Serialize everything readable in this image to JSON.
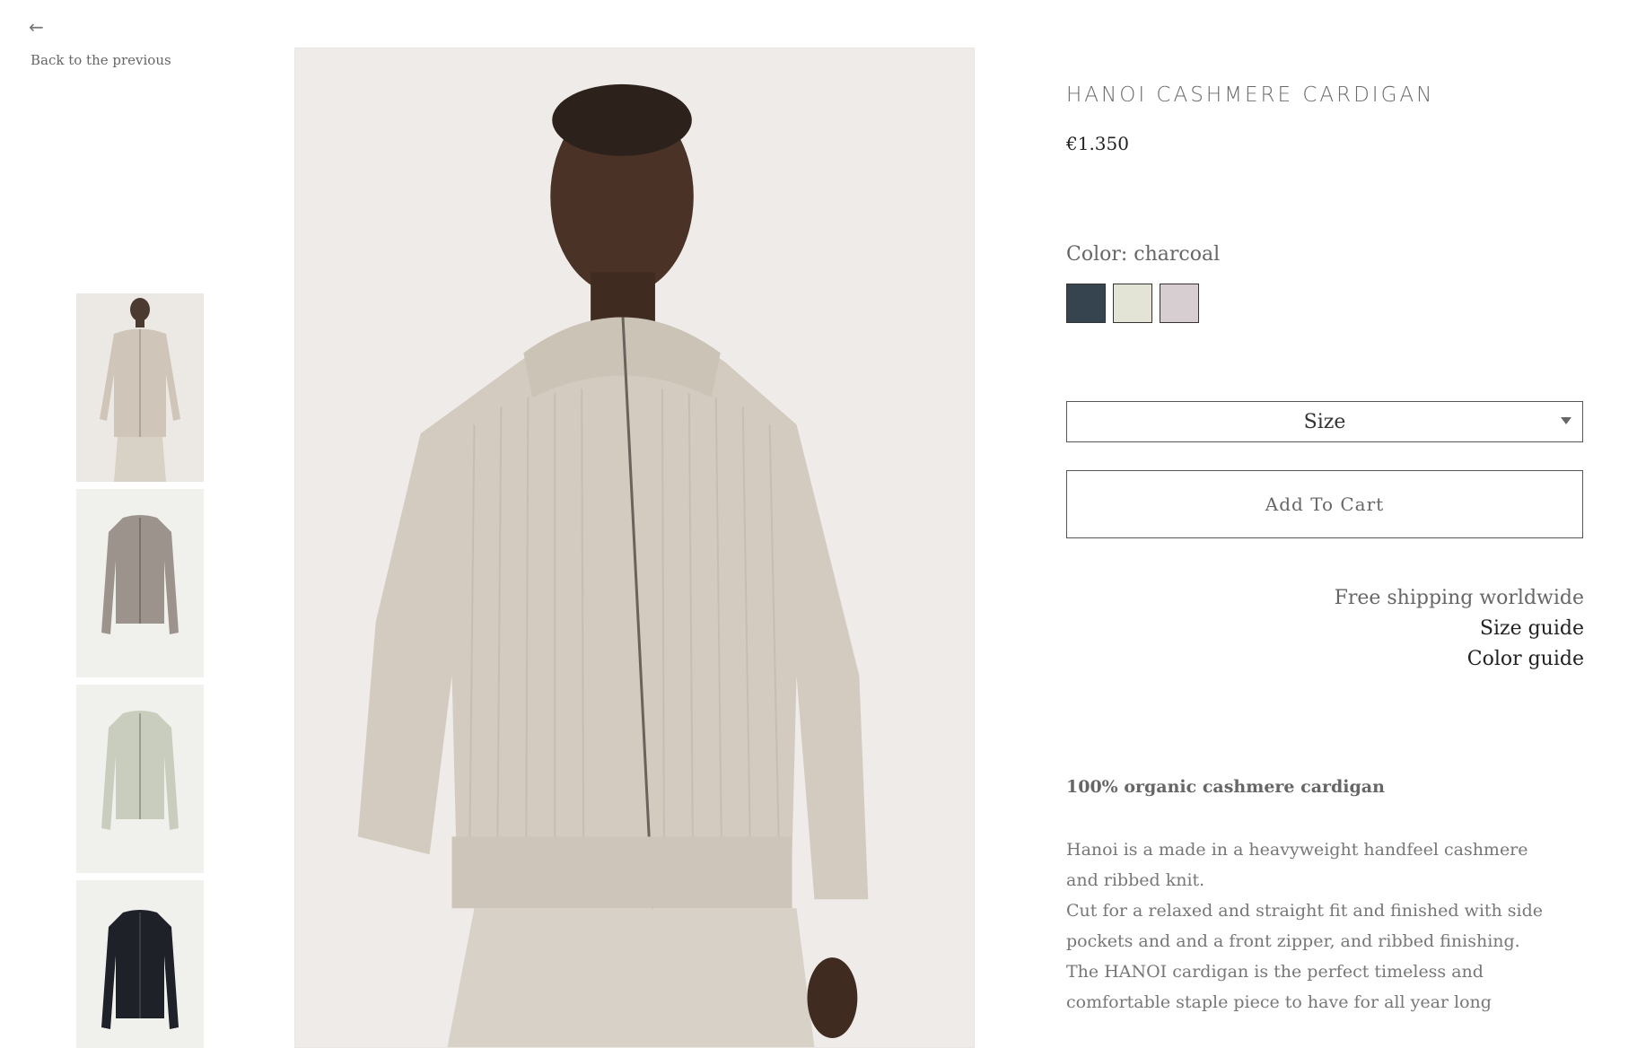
{
  "nav": {
    "back_icon": "left-arrow-icon",
    "back_label": "Back to the previous"
  },
  "product": {
    "title": "HANOI CASHMERE CARDIGAN",
    "price": "€1.350",
    "color_label": "Color: charcoal",
    "swatches": [
      {
        "name": "charcoal",
        "hex": "#36444f"
      },
      {
        "name": "cream",
        "hex": "#e4e4d6"
      },
      {
        "name": "light-grey",
        "hex": "#d6ced0"
      }
    ],
    "size_placeholder": "Size",
    "add_to_cart": "Add To Cart"
  },
  "info_links": {
    "shipping": "Free shipping worldwide",
    "size_guide": "Size guide",
    "color_guide": "Color guide"
  },
  "description": {
    "heading": "100% organic cashmere cardigan",
    "lines": [
      "Hanoi is a made in a heavyweight handfeel cashmere",
      "and ribbed knit.",
      "Cut for a relaxed and straight fit and finished with side",
      "pockets and and a front zipper, and ribbed finishing.",
      "The HANOI cardigan is the perfect timeless and",
      "comfortable staple piece to have for all year long"
    ]
  },
  "thumbnails": [
    {
      "kind": "model",
      "color": "#cfc6b9"
    },
    {
      "kind": "flat",
      "color": "#9c948c"
    },
    {
      "kind": "flat",
      "color": "#c9cdbd"
    },
    {
      "kind": "flat",
      "color": "#1e2228"
    }
  ]
}
